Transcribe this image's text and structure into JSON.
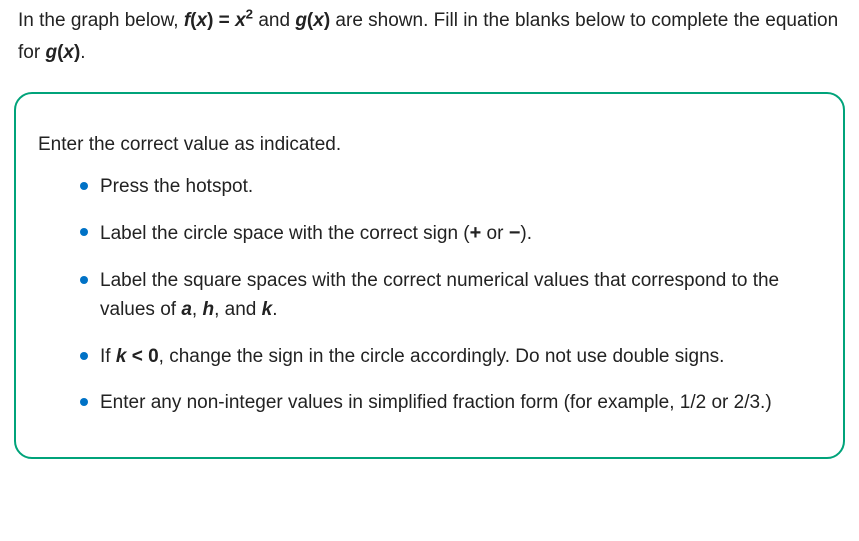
{
  "intro": {
    "prefix": "In the graph below, ",
    "f_label": "f",
    "paren_open": "(",
    "x_var": "x",
    "paren_close": ")",
    "eq": " = ",
    "x_sq_base": "x",
    "x_sq_exp": "2",
    "mid": " and ",
    "g_label": "g",
    "suffix": " are shown. Fill in the blanks below to complete the equation for ",
    "period": "."
  },
  "box": {
    "heading": "Enter the correct value as indicated.",
    "items": [
      {
        "text": "Press the hotspot."
      },
      {
        "pre": "Label the circle space with the correct sign (",
        "plus": "+",
        "or": " or ",
        "minus": "−",
        "post": ")."
      },
      {
        "pre": "Label the square spaces with the correct numerical values that correspond to the values of ",
        "a": "a",
        "c1": ", ",
        "h": "h",
        "c2": ", and ",
        "k": "k",
        "post": "."
      },
      {
        "pre": "If ",
        "k": "k",
        "lt": " < 0",
        "post": ", change the sign in the circle accordingly. Do not use double signs."
      },
      {
        "text": "Enter any non-integer values in simplified fraction form (for example, 1/2 or 2/3.)"
      }
    ]
  }
}
